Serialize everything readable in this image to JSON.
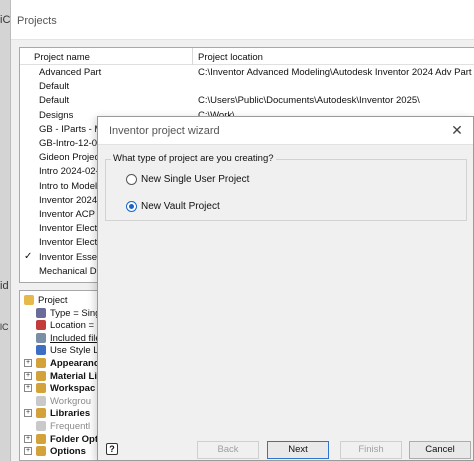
{
  "background": {
    "fragments": [
      "iC",
      "id",
      "lC"
    ]
  },
  "projects_window": {
    "title": "Projects",
    "columns": {
      "name": "Project name",
      "location": "Project location"
    },
    "projects": [
      {
        "name": "Advanced Part",
        "location": "C:\\Inventor Advanced Modeling\\Autodesk Inventor 2024 Adv Part Prt",
        "active": false
      },
      {
        "name": "Default",
        "location": "",
        "active": false
      },
      {
        "name": "Default",
        "location": "C:\\Users\\Public\\Documents\\Autodesk\\Inventor 2025\\",
        "active": false
      },
      {
        "name": "Designs",
        "location": "C:\\Work\\",
        "active": false
      },
      {
        "name": "GB - IParts - M",
        "location": "",
        "active": false
      },
      {
        "name": "GB-Intro-12-04",
        "location": "",
        "active": false
      },
      {
        "name": "Gideon Project",
        "location": "",
        "active": false
      },
      {
        "name": "Intro 2024-02-",
        "location": "",
        "active": false
      },
      {
        "name": "Intro to Modeli",
        "location": "",
        "active": false
      },
      {
        "name": "Inventor 2024-",
        "location": "",
        "active": false
      },
      {
        "name": "Inventor ACP D",
        "location": "",
        "active": false
      },
      {
        "name": "Inventor Electr",
        "location": "",
        "active": false
      },
      {
        "name": "Inventor Electr",
        "location": "",
        "active": false
      },
      {
        "name": "Inventor Essen",
        "location": "",
        "active": true
      },
      {
        "name": "Mechanical Dra",
        "location": "",
        "active": false
      }
    ],
    "active_check": "✓",
    "tree": [
      {
        "label": "Project",
        "indent": 0,
        "expander": "",
        "icon": "folder-icon",
        "icon_color": "#e7b84a",
        "style": ""
      },
      {
        "label": "Type = Sing",
        "indent": 1,
        "expander": "",
        "icon": "user-type-icon",
        "icon_color": "#6b6b9a",
        "style": ""
      },
      {
        "label": "Location = C",
        "indent": 1,
        "expander": "",
        "icon": "location-icon",
        "icon_color": "#c33b3b",
        "style": ""
      },
      {
        "label": "Included file",
        "indent": 1,
        "expander": "",
        "icon": "file-icon",
        "icon_color": "#7a8fa6",
        "style": "ul"
      },
      {
        "label": "Use Style Li",
        "indent": 1,
        "expander": "",
        "icon": "style-library-icon",
        "icon_color": "#3c6fc4",
        "style": ""
      },
      {
        "label": "Appearanc",
        "indent": 0,
        "expander": "+",
        "icon": "appearance-icon",
        "icon_color": "#d4a23a",
        "style": "bold"
      },
      {
        "label": "Material Li",
        "indent": 0,
        "expander": "+",
        "icon": "material-library-icon",
        "icon_color": "#d4a23a",
        "style": "bold"
      },
      {
        "label": "Workspac",
        "indent": 0,
        "expander": "+",
        "icon": "workspace-icon",
        "icon_color": "#d4a23a",
        "style": "bold"
      },
      {
        "label": "Workgrou",
        "indent": 0,
        "expander": "",
        "icon": "workgroup-icon",
        "icon_color": "#c9c9c9",
        "style": "grey"
      },
      {
        "label": "Libraries",
        "indent": 0,
        "expander": "+",
        "icon": "libraries-icon",
        "icon_color": "#d4a23a",
        "style": "bold"
      },
      {
        "label": "Frequentl",
        "indent": 0,
        "expander": "",
        "icon": "frequent-icon",
        "icon_color": "#c9c9c9",
        "style": "grey"
      },
      {
        "label": "Folder Opt",
        "indent": 0,
        "expander": "+",
        "icon": "folder-options-icon",
        "icon_color": "#d4a23a",
        "style": "bold"
      },
      {
        "label": "Options",
        "indent": 0,
        "expander": "+",
        "icon": "options-icon",
        "icon_color": "#d4a23a",
        "style": "bold"
      }
    ]
  },
  "wizard": {
    "title": "Inventor project wizard",
    "close_icon": "close-icon",
    "close_glyph": "✕",
    "question": "What type of project are you creating?",
    "options": [
      {
        "label": "New Single User Project",
        "selected": false
      },
      {
        "label": "New Vault Project",
        "selected": true
      }
    ],
    "help_glyph": "?",
    "buttons": {
      "back": {
        "label": "Back",
        "enabled": false
      },
      "next": {
        "label": "Next",
        "enabled": true
      },
      "finish": {
        "label": "Finish",
        "enabled": false
      },
      "cancel": {
        "label": "Cancel",
        "enabled": true
      }
    },
    "accent_color": "#1a64c8"
  }
}
